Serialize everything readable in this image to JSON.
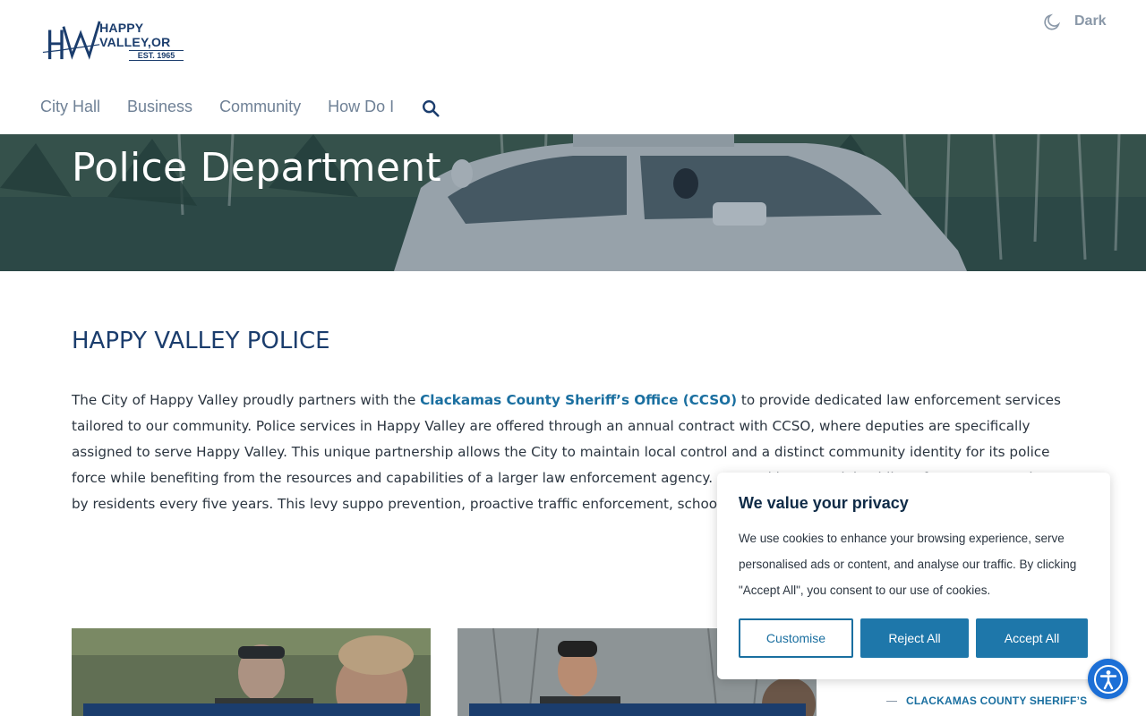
{
  "header": {
    "logo": {
      "name": "HAPPY VALLEY,OR",
      "est": "EST. 1965"
    },
    "dark_mode_label": "Dark",
    "nav": [
      {
        "label": "City Hall"
      },
      {
        "label": "Business"
      },
      {
        "label": "Community"
      },
      {
        "label": "How Do I"
      }
    ]
  },
  "hero": {
    "title": "Police Department"
  },
  "main": {
    "section_title": "HAPPY VALLEY POLICE",
    "paragraph": {
      "before_link": "The City of Happy Valley proudly partners with the ",
      "link_text": "Clackamas County Sheriff’s Office (CCSO)",
      "after_link": " to provide dedicated law enforcement services tailored to our community. Police services in Happy Valley are offered through an annual contract with CCSO, where deputies are specifically assigned to serve Happy Valley. This unique partnership allows the City to maintain local control and a distinct community identity for its police force while benefiting from the resources and capabilities of a larger law enforcement agency. covered by a special Public Safety Levy, voted on by residents every five years. This levy suppo prevention, proactive traffic enforcement, school safety, and quick emergency response."
    },
    "side_link": "CLACKAMAS COUNTY SHERIFF’S"
  },
  "cookie_banner": {
    "title": "We value your privacy",
    "text": "We use cookies to enhance your browsing experience, serve personalised ads or content, and analyse our traffic. By clicking \"Accept All\", you consent to our use of cookies.",
    "customise_label": "Customise",
    "reject_label": "Reject All",
    "accept_label": "Accept All"
  },
  "colors": {
    "brand_navy": "#1b3d6d",
    "link_blue": "#1a6fa0",
    "button_blue": "#1e77aa",
    "accessibility_blue": "#1c6fd6"
  },
  "icons": {
    "dark_mode": "moon-icon",
    "search": "search-icon",
    "accessibility": "accessibility-icon"
  }
}
